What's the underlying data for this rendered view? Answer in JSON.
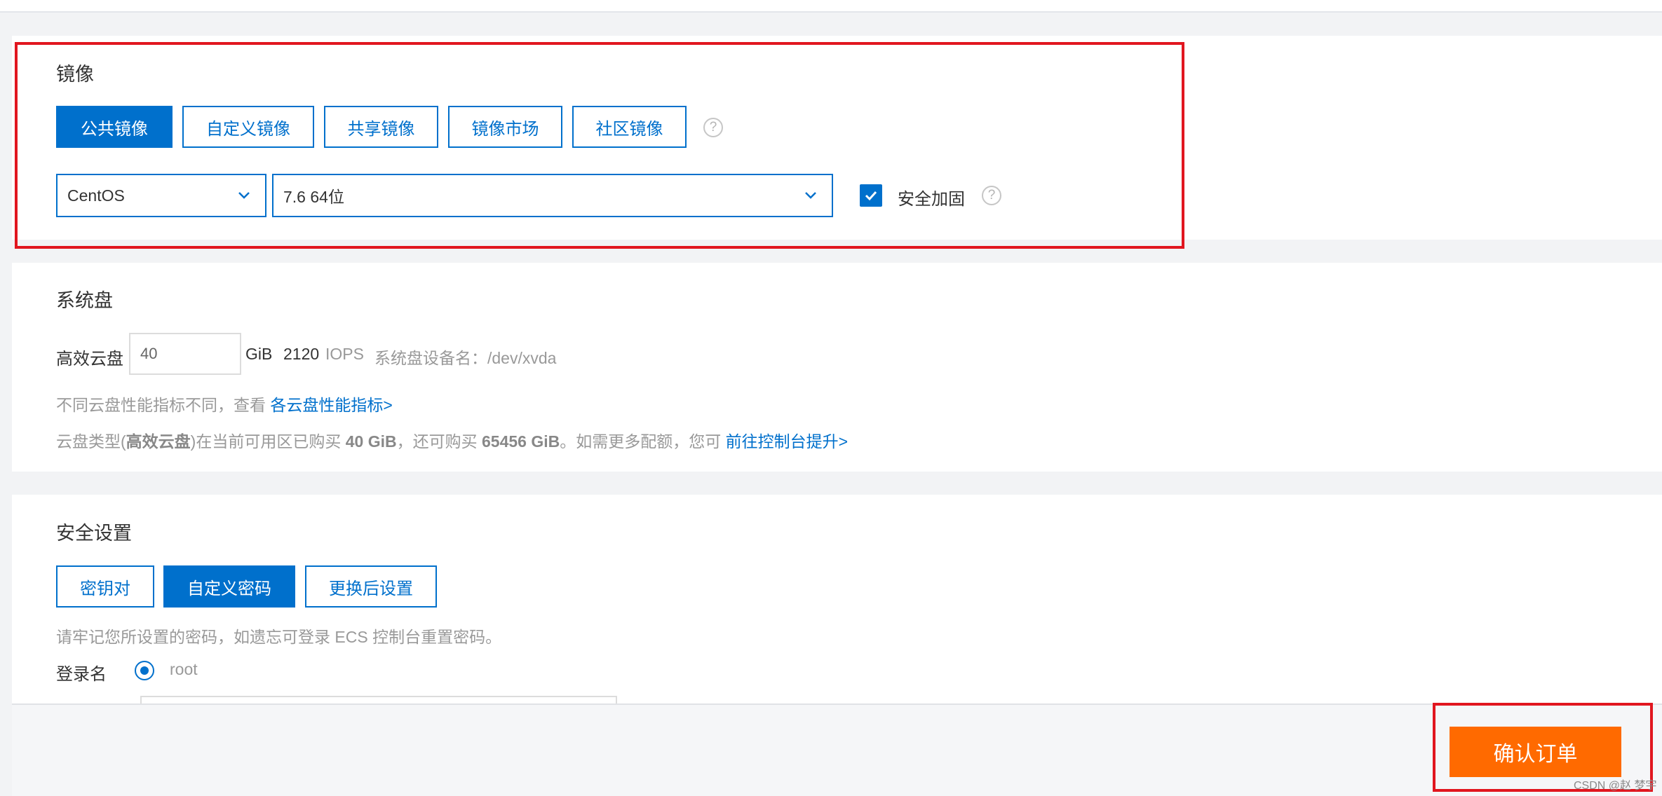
{
  "image_section": {
    "title": "镜像",
    "tabs": [
      {
        "label": "公共镜像",
        "active": true
      },
      {
        "label": "自定义镜像",
        "active": false
      },
      {
        "label": "共享镜像",
        "active": false
      },
      {
        "label": "镜像市场",
        "active": false
      },
      {
        "label": "社区镜像",
        "active": false
      }
    ],
    "help_glyph": "?",
    "os_select": {
      "value": "CentOS"
    },
    "version_select": {
      "value": "7.6 64位"
    },
    "security_harden": {
      "label": "安全加固",
      "checked": true
    }
  },
  "disk_section": {
    "title": "系统盘",
    "disk_type_label": "高效云盘",
    "size_value": "40",
    "size_unit": "GiB",
    "iops_value": "2120",
    "iops_unit": "IOPS",
    "device_label": "系统盘设备名：/dev/xvda",
    "perf_note": "不同云盘性能指标不同，查看",
    "perf_link": "各云盘性能指标>",
    "quota_prefix": "云盘类型(",
    "quota_type": "高效云盘",
    "quota_mid1": ")在当前可用区已购买",
    "quota_bought": "40 GiB",
    "quota_mid2": "，还可购买",
    "quota_remaining": "65456 GiB",
    "quota_mid3": "。如需更多配额，您可",
    "quota_link": "前往控制台提升>"
  },
  "security_section": {
    "title": "安全设置",
    "tabs": [
      {
        "label": "密钥对",
        "active": false
      },
      {
        "label": "自定义密码",
        "active": true
      },
      {
        "label": "更换后设置",
        "active": false
      }
    ],
    "note": "请牢记您所设置的密码，如遗忘可登录 ECS 控制台重置密码。",
    "login_label": "登录名",
    "login_value": "root"
  },
  "footer": {
    "confirm_label": "确认订单"
  },
  "watermark": "CSDN @赵 梦宇",
  "colors": {
    "primary": "#0070cc",
    "order": "#ff6a00",
    "highlight": "#e1161f"
  }
}
